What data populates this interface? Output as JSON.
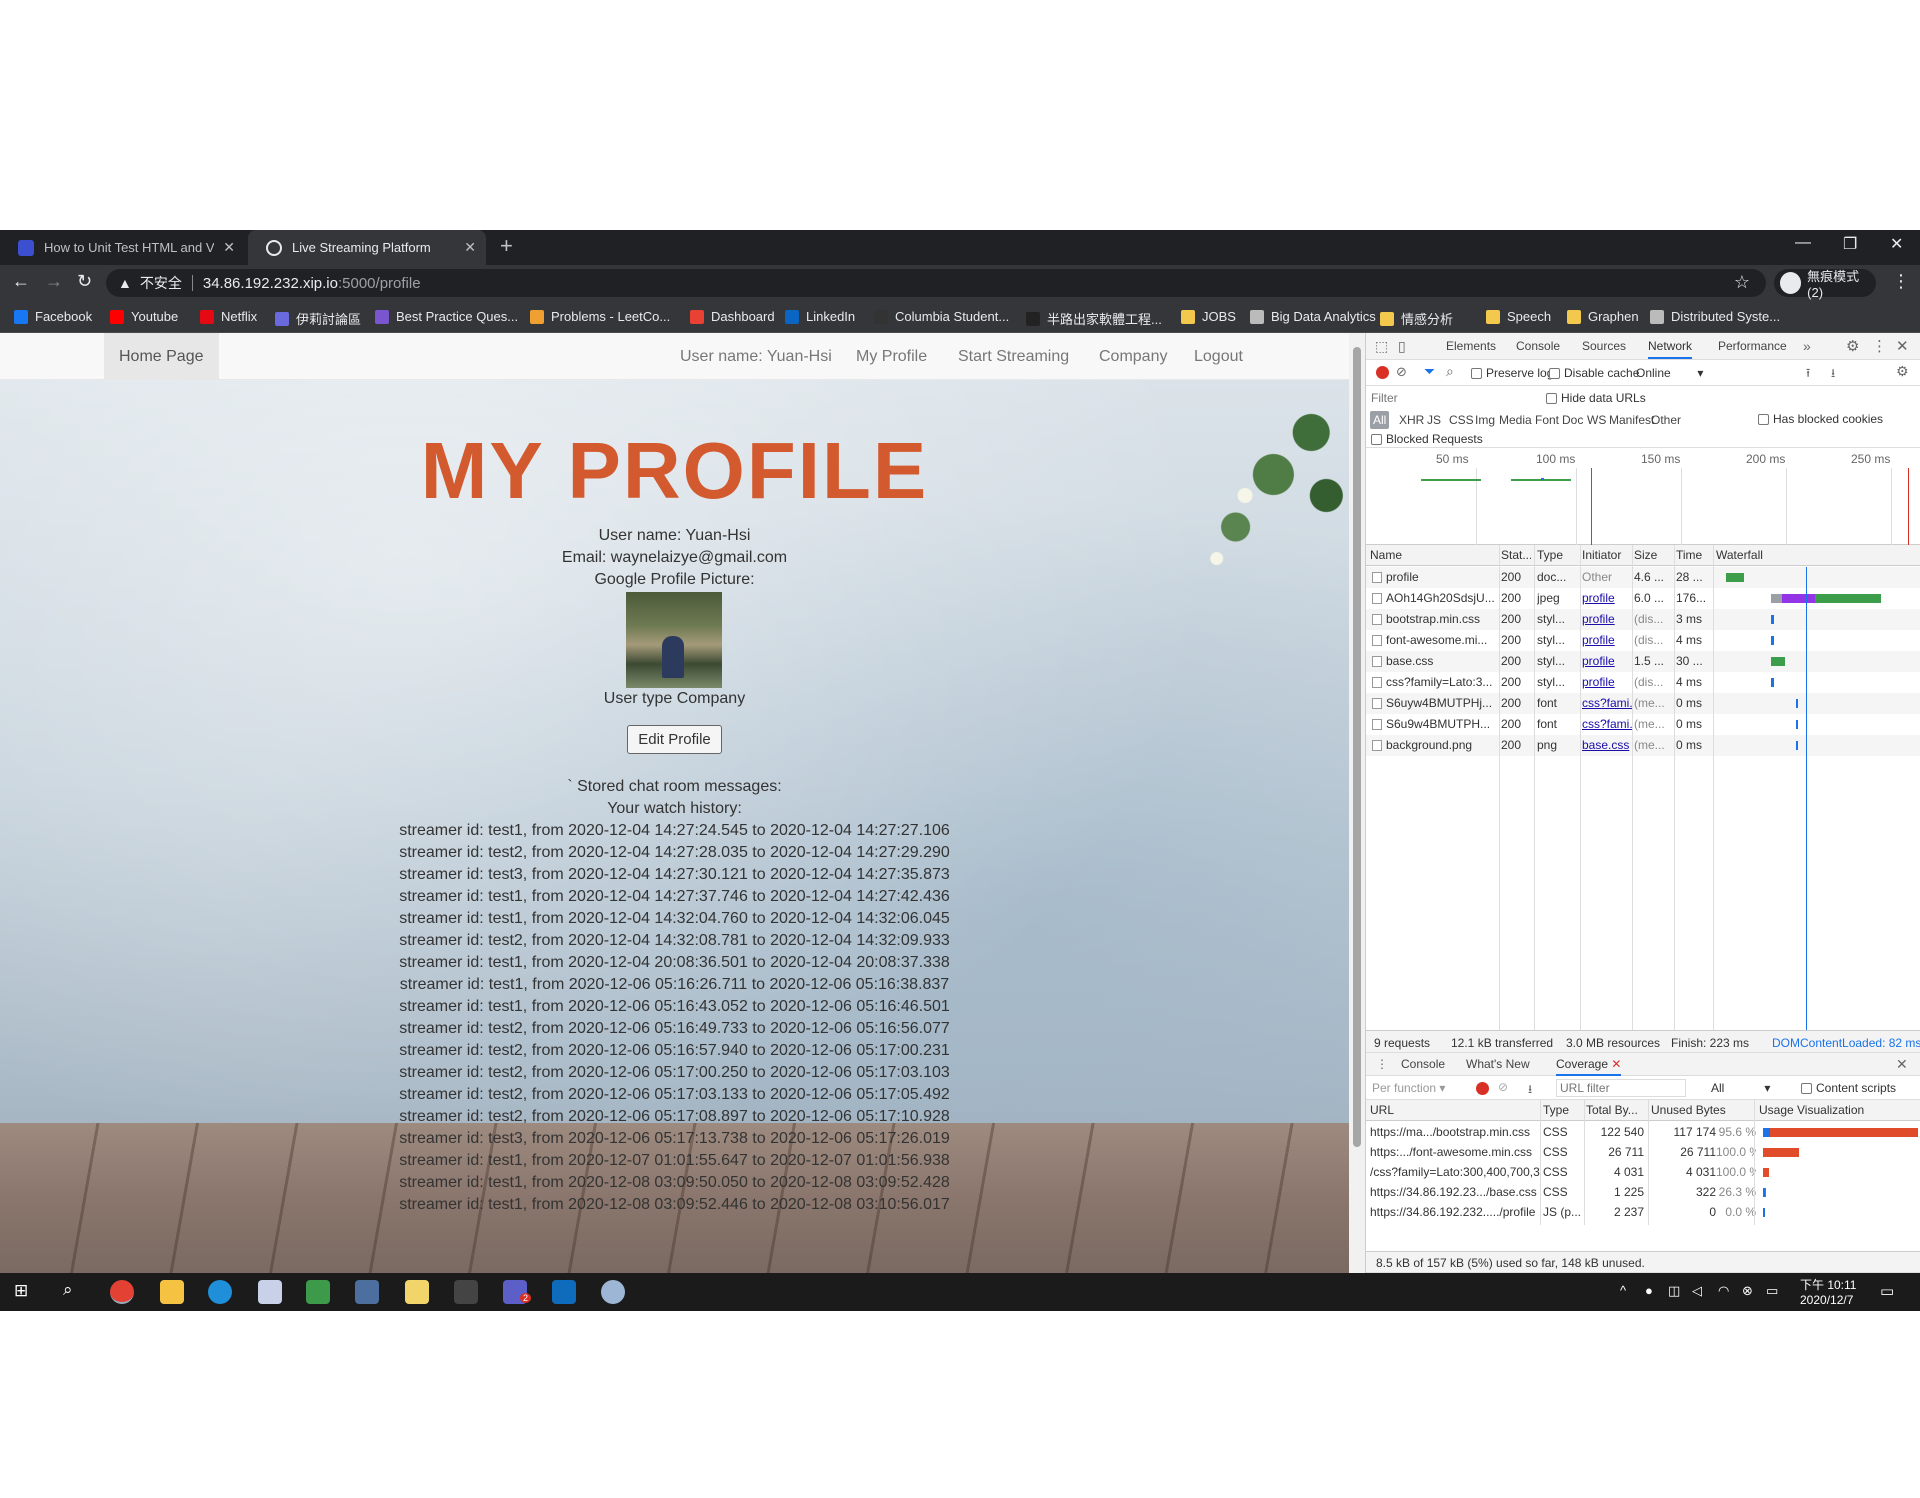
{
  "browser": {
    "tabs": [
      {
        "title": "How to Unit Test HTML and Va",
        "close": "✕"
      },
      {
        "title": "Live Streaming Platform",
        "close": "✕"
      }
    ],
    "new_tab": "+",
    "window_controls": {
      "minimize": "—",
      "restore": "❐",
      "close": "✕"
    },
    "nav": {
      "back": "←",
      "forward": "→",
      "reload": "↻"
    },
    "address": {
      "warning": "▲",
      "security": "不安全",
      "host": "34.86.192.232.xip.io",
      "path": ":5000/profile",
      "star": "☆"
    },
    "incognito": "無痕模式 (2)",
    "menu": "⋮",
    "bookmarks": [
      {
        "label": "Facebook",
        "color": "#1877f2"
      },
      {
        "label": "Youtube",
        "color": "#ff0000"
      },
      {
        "label": "Netflix",
        "color": "#e50914"
      },
      {
        "label": "伊莉討論區",
        "color": "#6a6adf"
      },
      {
        "label": "Best Practice Ques...",
        "color": "#7a55d0"
      },
      {
        "label": "Problems - LeetCo...",
        "color": "#f0a030"
      },
      {
        "label": "Dashboard",
        "color": "#e94235"
      },
      {
        "label": "LinkedIn",
        "color": "#0a66c2"
      },
      {
        "label": "Columbia Student...",
        "color": "#333333"
      },
      {
        "label": "半路出家軟體工程...",
        "color": "#222222"
      },
      {
        "label": "JOBS",
        "color": "#f2c94c"
      },
      {
        "label": "Big Data Analytics",
        "color": "#bbbbbb"
      },
      {
        "label": "情感分析",
        "color": "#f2c94c"
      },
      {
        "label": "Speech",
        "color": "#f2c94c"
      },
      {
        "label": "Graphen",
        "color": "#f2c94c"
      },
      {
        "label": "Distributed Syste...",
        "color": "#bbbbbb"
      }
    ]
  },
  "site": {
    "nav": {
      "home": "Home Page",
      "username": "User name: Yuan-Hsi",
      "profile": "My Profile",
      "streaming": "Start Streaming",
      "company": "Company",
      "logout": "Logout"
    },
    "title": "MY PROFILE",
    "user_name_line": "User name: Yuan-Hsi",
    "email_line": "Email: waynelaizye@gmail.com",
    "picture_label": "Google Profile Picture:",
    "user_type_line": "User type Company",
    "edit_button": "Edit Profile",
    "chat_label": "` Stored chat room messages:",
    "history_label": "Your watch history:",
    "history": [
      "streamer id: test1, from 2020-12-04 14:27:24.545 to 2020-12-04 14:27:27.106",
      "streamer id: test2, from 2020-12-04 14:27:28.035 to 2020-12-04 14:27:29.290",
      "streamer id: test3, from 2020-12-04 14:27:30.121 to 2020-12-04 14:27:35.873",
      "streamer id: test1, from 2020-12-04 14:27:37.746 to 2020-12-04 14:27:42.436",
      "streamer id: test1, from 2020-12-04 14:32:04.760 to 2020-12-04 14:32:06.045",
      "streamer id: test2, from 2020-12-04 14:32:08.781 to 2020-12-04 14:32:09.933",
      "streamer id: test1, from 2020-12-04 20:08:36.501 to 2020-12-04 20:08:37.338",
      "streamer id: test1, from 2020-12-06 05:16:26.711 to 2020-12-06 05:16:38.837",
      "streamer id: test1, from 2020-12-06 05:16:43.052 to 2020-12-06 05:16:46.501",
      "streamer id: test2, from 2020-12-06 05:16:49.733 to 2020-12-06 05:16:56.077",
      "streamer id: test2, from 2020-12-06 05:16:57.940 to 2020-12-06 05:17:00.231",
      "streamer id: test2, from 2020-12-06 05:17:00.250 to 2020-12-06 05:17:03.103",
      "streamer id: test2, from 2020-12-06 05:17:03.133 to 2020-12-06 05:17:05.492",
      "streamer id: test2, from 2020-12-06 05:17:08.897 to 2020-12-06 05:17:10.928",
      "streamer id: test3, from 2020-12-06 05:17:13.738 to 2020-12-06 05:17:26.019",
      "streamer id: test1, from 2020-12-07 01:01:55.647 to 2020-12-07 01:01:56.938",
      "streamer id: test1, from 2020-12-08 03:09:50.050 to 2020-12-08 03:09:52.428",
      "streamer id: test1, from 2020-12-08 03:09:52.446 to 2020-12-08 03:10:56.017"
    ]
  },
  "devtools": {
    "panel_tabs": [
      "Elements",
      "Console",
      "Sources",
      "Network",
      "Performance"
    ],
    "more": "»",
    "preserve_log": "Preserve log",
    "disable_cache": "Disable cache",
    "throttle": "Online",
    "filter_placeholder": "Filter",
    "hide_data_urls": "Hide data URLs",
    "types": [
      "All",
      "XHR",
      "JS",
      "CSS",
      "Img",
      "Media",
      "Font",
      "Doc",
      "WS",
      "Manifest",
      "Other"
    ],
    "has_blocked_cookies": "Has blocked cookies",
    "blocked_requests": "Blocked Requests",
    "timeline_ticks": [
      "50 ms",
      "100 ms",
      "150 ms",
      "200 ms",
      "250 ms"
    ],
    "headers": [
      "Name",
      "Stat...",
      "Type",
      "Initiator",
      "Size",
      "Time",
      "Waterfall"
    ],
    "requests": [
      {
        "name": "profile",
        "status": "200",
        "type": "doc...",
        "initiator": "Other",
        "size": "4.6 ...",
        "time": "28 ..."
      },
      {
        "name": "AOh14Gh20SdsjU...",
        "status": "200",
        "type": "jpeg",
        "initiator": "profile",
        "size": "6.0 ...",
        "time": "176..."
      },
      {
        "name": "bootstrap.min.css",
        "status": "200",
        "type": "styl...",
        "initiator": "profile",
        "size": "(dis...",
        "time": "3 ms"
      },
      {
        "name": "font-awesome.mi...",
        "status": "200",
        "type": "styl...",
        "initiator": "profile",
        "size": "(dis...",
        "time": "4 ms"
      },
      {
        "name": "base.css",
        "status": "200",
        "type": "styl...",
        "initiator": "profile",
        "size": "1.5 ...",
        "time": "30 ..."
      },
      {
        "name": "css?family=Lato:3...",
        "status": "200",
        "type": "styl...",
        "initiator": "profile",
        "size": "(dis...",
        "time": "4 ms"
      },
      {
        "name": "S6uyw4BMUTPHj...",
        "status": "200",
        "type": "font",
        "initiator": "css?fami...",
        "size": "(me...",
        "time": "0 ms"
      },
      {
        "name": "S6u9w4BMUTPH...",
        "status": "200",
        "type": "font",
        "initiator": "css?fami...",
        "size": "(me...",
        "time": "0 ms"
      },
      {
        "name": "background.png",
        "status": "200",
        "type": "png",
        "initiator": "base.css",
        "size": "(me...",
        "time": "0 ms"
      }
    ],
    "summary": {
      "requests": "9 requests",
      "transferred": "12.1 kB transferred",
      "resources": "3.0 MB resources",
      "finish": "Finish: 223 ms",
      "dcl": "DOMContentLoaded: 82 ms"
    },
    "drawer_tabs": [
      "Console",
      "What's New",
      "Coverage"
    ],
    "coverage": {
      "per_function": "Per function",
      "url_filter_placeholder": "URL filter",
      "type_filter": "All",
      "content_scripts": "Content scripts",
      "headers": [
        "URL",
        "Type",
        "Total By...",
        "Unused Bytes",
        "Usage Visualization"
      ],
      "rows": [
        {
          "url": "https://ma.../bootstrap.min.css",
          "type": "CSS",
          "total": "122 540",
          "unused": "117 174",
          "pct": "95.6 %"
        },
        {
          "url": "https:.../font-awesome.min.css",
          "type": "CSS",
          "total": "26 711",
          "unused": "26 711",
          "pct": "100.0 %"
        },
        {
          "url": "/css?family=Lato:300,400,700,3",
          "type": "CSS",
          "total": "4 031",
          "unused": "4 031",
          "pct": "100.0 %"
        },
        {
          "url": "https://34.86.192.23.../base.css",
          "type": "CSS",
          "total": "1 225",
          "unused": "322",
          "pct": "26.3 %"
        },
        {
          "url": "https://34.86.192.232...../profile",
          "type": "JS (p...",
          "total": "2 237",
          "unused": "0",
          "pct": "0.0 %"
        }
      ],
      "footer": "8.5 kB of 157 kB (5%) used so far, 148 kB unused."
    }
  },
  "taskbar": {
    "time": "下午 10:11",
    "date": "2020/12/7",
    "teams_badge": "2"
  }
}
